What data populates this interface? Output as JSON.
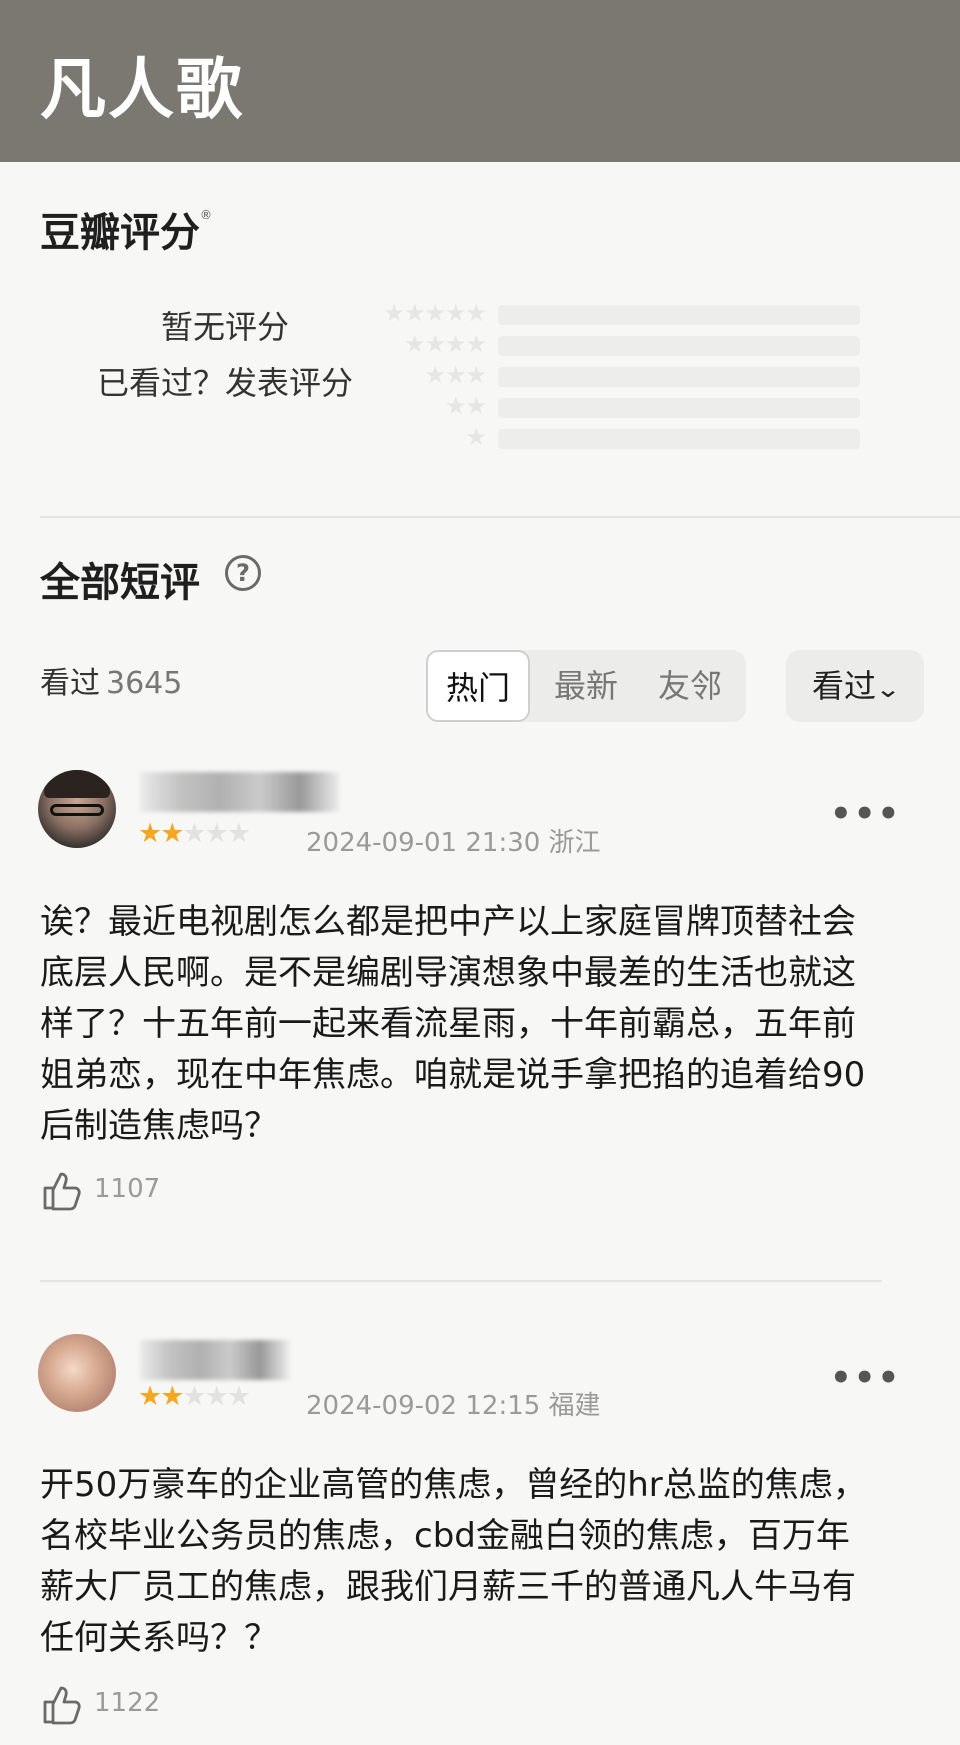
{
  "header": {
    "title": "凡人歌"
  },
  "rating": {
    "title": "豆瓣评分",
    "registered_mark": "®",
    "no_rating": "暂无评分",
    "rate_prompt": "已看过？发表评分",
    "distribution_stars": [
      "★★★★★",
      "★★★★",
      "★★★",
      "★★",
      "★"
    ]
  },
  "comments": {
    "title": "全部短评",
    "help_icon": "question-circle-icon",
    "watched_label": "看过",
    "watched_count": "3645",
    "tabs": [
      {
        "label": "热门",
        "active": true
      },
      {
        "label": "最新",
        "active": false
      },
      {
        "label": "友邻",
        "active": false
      }
    ],
    "filter": {
      "label": "看过",
      "icon": "chevron-down-icon"
    },
    "reviews": [
      {
        "stars_on": "★★",
        "stars_off": "★★★",
        "rating": 2,
        "meta": "2024-09-01 21:30 浙江",
        "more": "•••",
        "text": "诶？最近电视剧怎么都是把中产以上家庭冒牌顶替社会底层人民啊。是不是编剧导演想象中最差的生活也就这样了？十五年前一起来看流星雨，十年前霸总，五年前姐弟恋，现在中年焦虑。咱就是说手拿把掐的追着给90后制造焦虑吗？",
        "likes": "1107"
      },
      {
        "stars_on": "★★",
        "stars_off": "★★★",
        "rating": 2,
        "meta": "2024-09-02 12:15 福建",
        "more": "•••",
        "text": "开50万豪车的企业高管的焦虑，曾经的hr总监的焦虑，名校毕业公务员的焦虑，cbd金融白领的焦虑，百万年薪大厂员工的焦虑，跟我们月薪三千的普通凡人牛马有任何关系吗？？",
        "likes": "1122"
      }
    ]
  }
}
